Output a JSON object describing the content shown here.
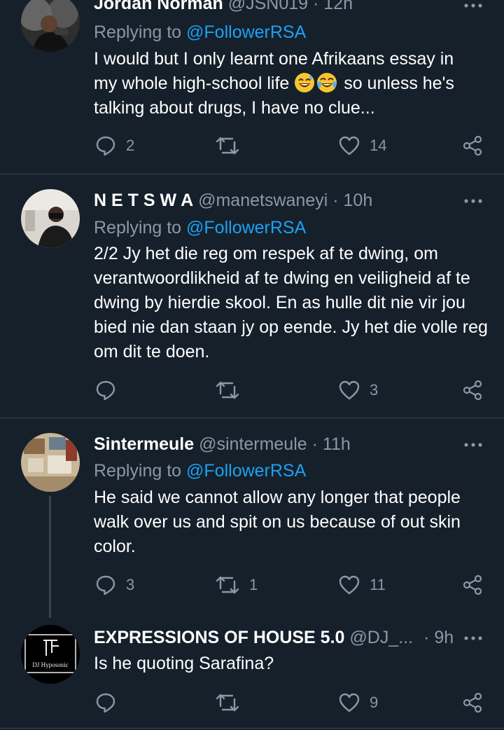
{
  "colors": {
    "background": "#15202b",
    "text": "#ffffff",
    "muted": "#8899a6",
    "link": "#1da1f2",
    "divider": "#38444d"
  },
  "tweets": [
    {
      "name": "Jordan Norman",
      "handle": "@JSN019",
      "dot": "·",
      "time": "12h",
      "replying_prefix": "Replying to",
      "replying_to": "@FollowerRSA",
      "text_line1": "I would but I only learnt one Afrikaans essay in",
      "text_line2_a": "my whole high-school life",
      "text_line2_b": "so unless he's",
      "text_line3": "talking about drugs, I have no clue...",
      "emojis": [
        "grinning-sweat-emoji",
        "tears-of-joy-emoji"
      ],
      "replies": "2",
      "retweets": "",
      "likes": "14"
    },
    {
      "name": "N E T S W A",
      "handle": "@manetswaneyi",
      "dot": "·",
      "time": "10h",
      "replying_prefix": "Replying to",
      "replying_to": "@FollowerRSA",
      "text": "2/2 Jy het die reg om respek af te dwing, om verantwoordlikheid af te dwing en veiligheid af te dwing by hierdie skool. En as hulle dit nie vir jou bied nie dan staan jy op eende. Jy het die volle reg om dit te doen.",
      "replies": "",
      "retweets": "",
      "likes": "3"
    },
    {
      "name": "Sintermeule",
      "handle": "@sintermeule",
      "dot": "·",
      "time": "11h",
      "replying_prefix": "Replying to",
      "replying_to": "@FollowerRSA",
      "text": "He said we cannot allow any longer that people walk over us and spit on us because of out skin color.",
      "replies": "3",
      "retweets": "1",
      "likes": "11"
    },
    {
      "name": "EXPRESSIONS OF HOUSE 5.0",
      "handle": "@DJ_...",
      "dot": "·",
      "time": "9h",
      "text": "Is he quoting Sarafina?",
      "avatar_label": "DJ Hyposonic",
      "replies": "",
      "retweets": "",
      "likes": "9"
    }
  ]
}
